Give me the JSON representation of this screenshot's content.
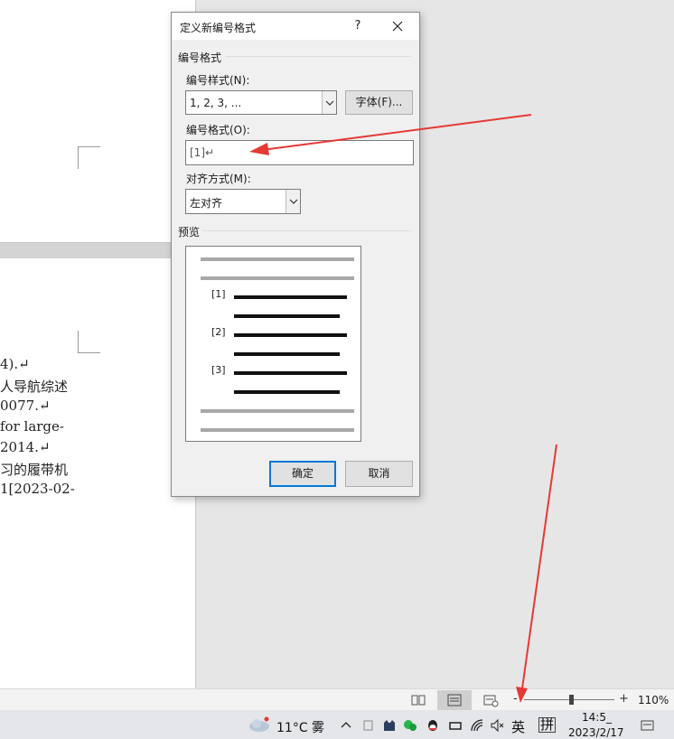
{
  "document": {
    "lines": [
      "4).↵",
      "人导航综述",
      "0077.↵",
      "for large-",
      " 2014.↵",
      "习的履带机",
      "1[2023-02-"
    ]
  },
  "dialog": {
    "title": "定义新编号格式",
    "help": "?",
    "number_format_group": "编号格式",
    "number_style_label": "编号样式(N):",
    "number_style_value": "1, 2, 3, ...",
    "font_button": "字体(F)...",
    "number_format_label": "编号格式(O):",
    "number_format_value": "[1]↵",
    "alignment_label": "对齐方式(M):",
    "alignment_value": "左对齐",
    "preview_label": "预览",
    "preview_numbers": [
      "[1]",
      "[2]",
      "[3]"
    ],
    "ok_button": "确定",
    "cancel_button": "取消"
  },
  "statusbar": {
    "zoom": "110%",
    "zoom_minus": "-",
    "zoom_plus": "+"
  },
  "taskbar": {
    "weather": "11°C 雾",
    "ime_lang": "英",
    "ime_mode": "拼",
    "time": "14:5_",
    "date": "2023/2/17"
  },
  "colors": {
    "accent": "#0078d7",
    "annotation_red": "#e53935"
  }
}
